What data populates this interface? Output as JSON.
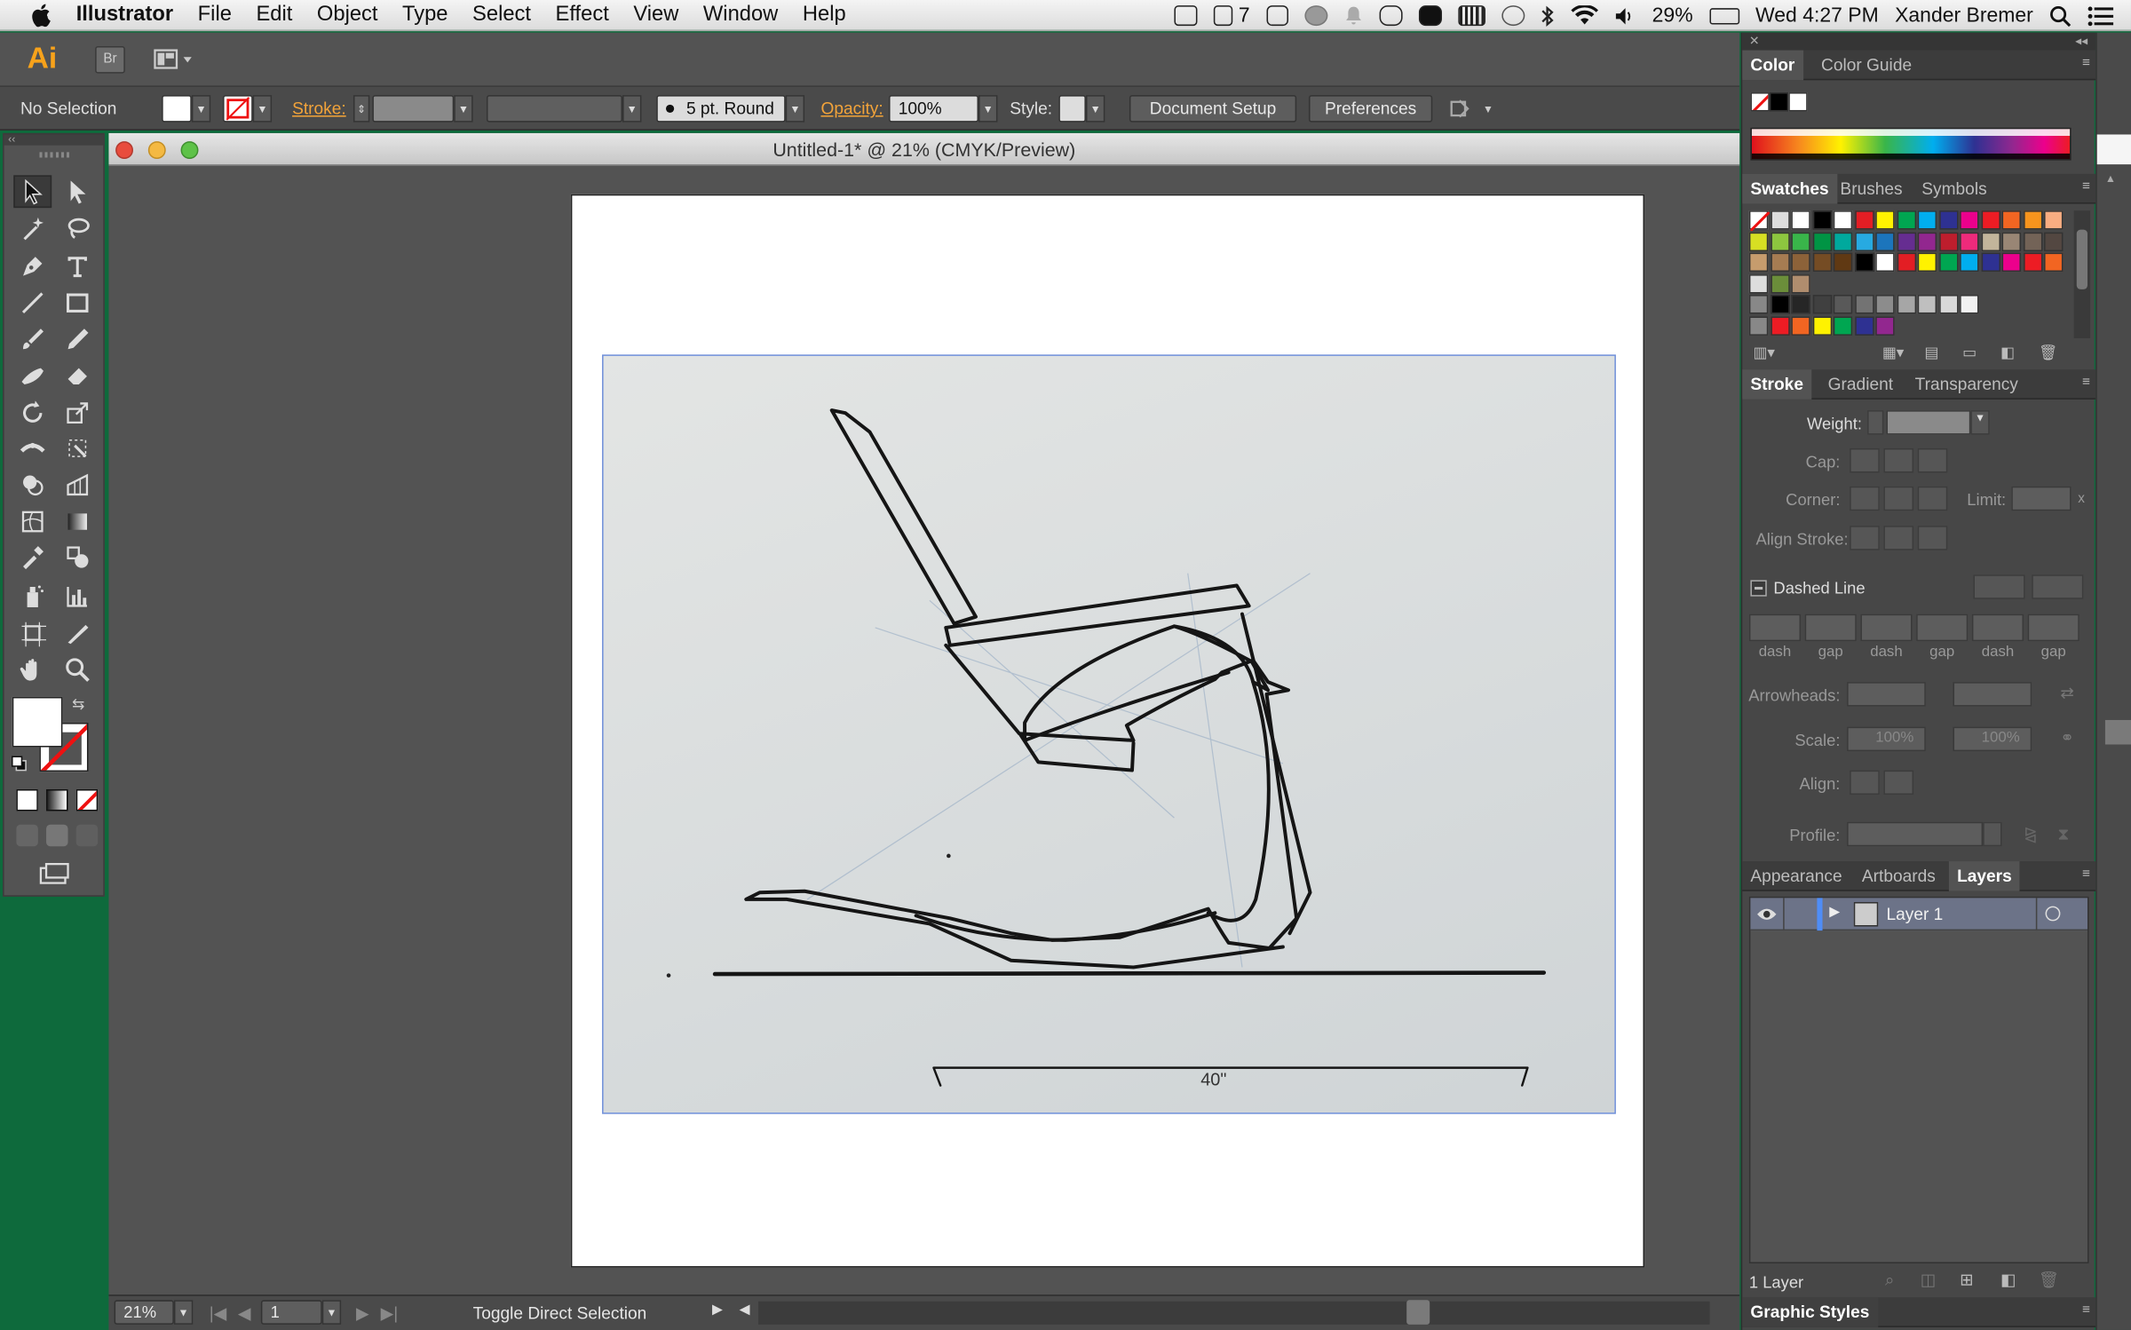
{
  "menubar": {
    "app": "Illustrator",
    "items": [
      "File",
      "Edit",
      "Object",
      "Type",
      "Select",
      "Effect",
      "View",
      "Window",
      "Help"
    ],
    "status": {
      "notifications": "7",
      "battery": "29%",
      "clock": "Wed 4:27 PM",
      "user": "Xander Bremer"
    }
  },
  "appbar": {
    "logo": "Ai",
    "bridge": "Br"
  },
  "control": {
    "selection": "No Selection",
    "stroke_label": "Stroke:",
    "brush": "5 pt. Round",
    "opacity_label": "Opacity:",
    "opacity": "100%",
    "style_label": "Style:",
    "document_setup": "Document Setup",
    "preferences": "Preferences"
  },
  "document": {
    "title": "Untitled-1* @ 21% (CMYK/Preview)",
    "sketch_label": "40\""
  },
  "bottom": {
    "zoom": "21%",
    "artboard": "1",
    "status": "Toggle Direct Selection"
  },
  "panels": {
    "color": {
      "tabs": [
        "Color",
        "Color Guide"
      ]
    },
    "swatches": {
      "tabs": [
        "Swatches",
        "Brushes",
        "Symbols"
      ]
    },
    "stroke": {
      "tabs": [
        "Stroke",
        "Gradient",
        "Transparency"
      ],
      "weight": "Weight:",
      "cap": "Cap:",
      "corner": "Corner:",
      "limit": "Limit:",
      "align_stroke": "Align Stroke:",
      "dashed_line": "Dashed Line",
      "dash_labels": [
        "dash",
        "gap",
        "dash",
        "gap",
        "dash",
        "gap"
      ],
      "arrowheads": "Arrowheads:",
      "scale": "Scale:",
      "scale_a": "100%",
      "scale_b": "100%",
      "align": "Align:",
      "profile": "Profile:",
      "limit_x": "x"
    },
    "layers": {
      "tabs": [
        "Appearance",
        "Artboards",
        "Layers"
      ],
      "layer_name": "Layer 1",
      "count": "1 Layer"
    },
    "graphic_styles": {
      "tab": "Graphic Styles"
    }
  },
  "swatch_colors": [
    "#000000",
    "#ffffff",
    "#e31e24",
    "#fff200",
    "#00a651",
    "#00aeef",
    "#2e3192",
    "#ec008c",
    "#ed1c24",
    "#f26522",
    "#f7941d",
    "#f9ad81",
    "#d7df23",
    "#8dc63f",
    "#39b54a",
    "#009444",
    "#00a99d",
    "#27aae1",
    "#1c75bc",
    "#662d91",
    "#92278f",
    "#be1e2d",
    "#ee2a7b",
    "#c2b59b",
    "#998675",
    "#736357",
    "#534741",
    "#c69c6d",
    "#a67c52",
    "#8c6239",
    "#754c24",
    "#603913"
  ],
  "grays": [
    "#000000",
    "#262626",
    "#404040",
    "#595959",
    "#737373",
    "#8c8c8c",
    "#a6a6a6",
    "#bfbfbf",
    "#d9d9d9",
    "#f2f2f2"
  ],
  "bright": [
    "#ed1c24",
    "#f26522",
    "#fff200",
    "#00a651",
    "#2e3192",
    "#92278f"
  ]
}
